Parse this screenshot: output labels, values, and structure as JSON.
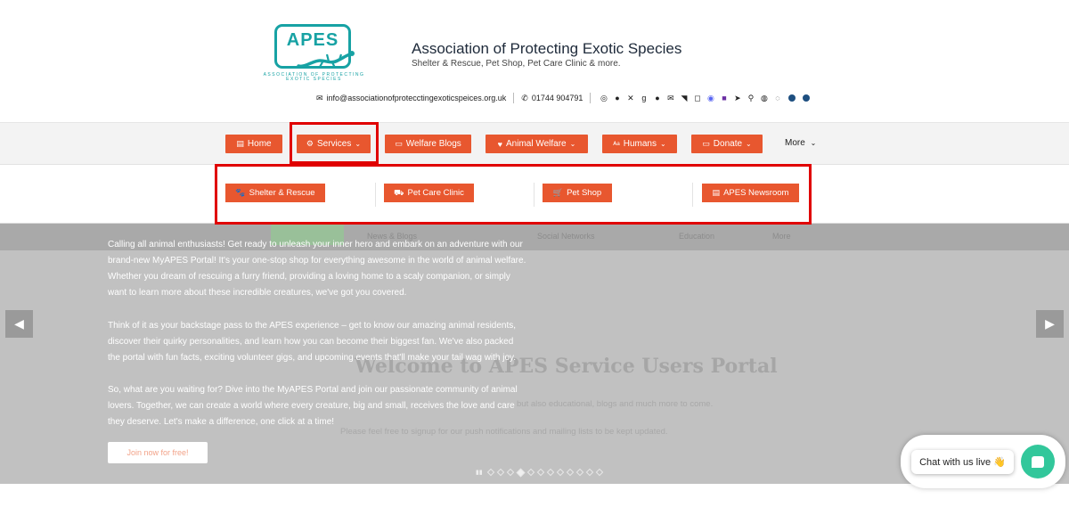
{
  "colors": {
    "brand_orange": "#e8572f",
    "logo_teal": "#17a2a4",
    "highlight_red": "#e00000",
    "chat_green": "#32c79b"
  },
  "header": {
    "logo_text": "APES",
    "logo_subtext": "ASSOCIATION OF PROTECTING EXOTIC SPECIES",
    "site_title": "Association of Protecting Exotic Species",
    "site_tagline": "Shelter & Rescue, Pet Shop, Pet Care Clinic & more.",
    "email": "info@associationofprotecctingexoticspeices.org.uk",
    "phone": "01744 904791",
    "social_icons": [
      "whatsapp-icon",
      "facebook-icon",
      "x-icon",
      "google-plus-icon",
      "pinterest-icon",
      "email-icon",
      "rss-icon",
      "instagram-icon",
      "discord-icon",
      "patreon-icon",
      "telegram-icon",
      "location-icon",
      "messenger-icon",
      "globe-icon",
      "circle-icon",
      "circle-icon"
    ]
  },
  "nav": {
    "items": [
      {
        "label": "Home",
        "icon": "page-icon",
        "dropdown": false
      },
      {
        "label": "Services",
        "icon": "gear-icon",
        "dropdown": true
      },
      {
        "label": "Welfare Blogs",
        "icon": "news-icon",
        "dropdown": false
      },
      {
        "label": "Animal Welfare",
        "icon": "heart-icon",
        "dropdown": true
      },
      {
        "label": "Humans",
        "icon": "users-icon",
        "dropdown": true
      },
      {
        "label": "Donate",
        "icon": "money-icon",
        "dropdown": true
      }
    ],
    "more_label": "More"
  },
  "dropdown": {
    "items": [
      {
        "label": "Shelter & Rescue",
        "icon": "paw-icon"
      },
      {
        "label": "Pet Care Clinic",
        "icon": "ambulance-icon"
      },
      {
        "label": "Pet Shop",
        "icon": "cart-icon"
      },
      {
        "label": "APES Newsroom",
        "icon": "newspaper-icon"
      }
    ]
  },
  "hero": {
    "ghost_nav": [
      "News & Blogs",
      "Social Networks",
      "Education",
      "More"
    ],
    "paragraphs": [
      "Calling all animal enthusiasts! Get ready to unleash your inner hero and embark on an adventure with our brand-new MyAPES Portal! It's your one-stop shop for everything awesome in the world of animal welfare. Whether you dream of rescuing a furry friend, providing a loving home to a scaly companion, or simply want to learn more about these incredible creatures, we've got you covered.",
      "Think of it as your backstage pass to the APES experience – get to know our amazing animal residents, discover their quirky personalities, and learn how you can become their biggest fan. We've also packed the portal with fun facts, exciting volunteer gigs, and upcoming events that'll make your tail wag with joy.",
      "So, what are you waiting for? Dive into the MyAPES Portal and join our passionate community of animal lovers. Together, we can create a world where every creature, big and small, receives the love and care they deserve. Let's make a difference, one click at a time!"
    ],
    "join_label": "Join now for free!",
    "welcome_title": "Welcome to APES Service Users Portal",
    "welcome_line1": "but also educational, blogs and much more to come.",
    "welcome_line2": "Please feel free to signup for our push notifications and mailing lists to be kept updated."
  },
  "chat": {
    "label": "Chat with us live 👋"
  }
}
